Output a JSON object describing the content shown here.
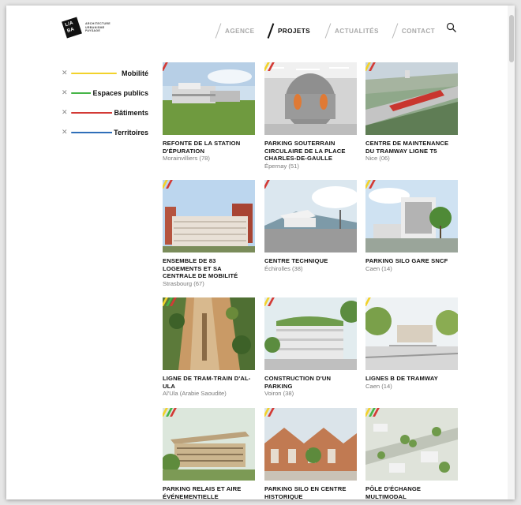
{
  "logo": {
    "mark_line1": "L/A",
    "mark_line2": "BA",
    "tagline": [
      "ARCHITECTURE",
      "URBANISME",
      "PAYSAGE"
    ]
  },
  "nav": {
    "items": [
      {
        "label": "AGENCE",
        "active": false
      },
      {
        "label": "PROJETS",
        "active": true
      },
      {
        "label": "ACTUALITÉS",
        "active": false
      },
      {
        "label": "CONTACT",
        "active": false
      }
    ],
    "search_icon": "search-icon"
  },
  "colors": {
    "yellow": "#f2d22b",
    "green": "#46b548",
    "red": "#d33a35",
    "blue": "#2f6fb9"
  },
  "filters": [
    {
      "label": "Mobilité",
      "color": "#f2d22b"
    },
    {
      "label": "Espaces publics",
      "color": "#46b548"
    },
    {
      "label": "Bâtiments",
      "color": "#d33a35"
    },
    {
      "label": "Territoires",
      "color": "#2f6fb9"
    }
  ],
  "projects": [
    {
      "title": "REFONTE DE LA STATION D'ÉPURATION",
      "location": "Morainvilliers (78)",
      "tags": [
        "red"
      ],
      "scene": "plant"
    },
    {
      "title": "PARKING SOUTERRAIN CIRCULAIRE DE LA PLACE CHARLES-DE-GAULLE",
      "location": "Épernay (51)",
      "tags": [
        "yellow",
        "red"
      ],
      "scene": "underground"
    },
    {
      "title": "CENTRE DE MAINTENANCE DU TRAMWAY LIGNE T5",
      "location": "Nice (06)",
      "tags": [
        "yellow",
        "red"
      ],
      "scene": "depot"
    },
    {
      "title": "ENSEMBLE DE 83 LOGEMENTS ET SA CENTRALE DE MOBILITÉ",
      "location": "Strasbourg (67)",
      "tags": [
        "yellow",
        "red"
      ],
      "scene": "housing"
    },
    {
      "title": "CENTRE TECHNIQUE",
      "location": "Échirolles (38)",
      "tags": [
        "red"
      ],
      "scene": "technique"
    },
    {
      "title": "PARKING SILO GARE SNCF",
      "location": "Caen (14)",
      "tags": [
        "yellow",
        "red"
      ],
      "scene": "silo"
    },
    {
      "title": "LIGNE DE TRAM-TRAIN D'AL-ULA",
      "location": "Al'Ula (Arabie Saoudite)",
      "tags": [
        "yellow",
        "green",
        "red"
      ],
      "scene": "desert"
    },
    {
      "title": "CONSTRUCTION D'UN PARKING",
      "location": "Voiron (38)",
      "tags": [
        "yellow",
        "red"
      ],
      "scene": "green"
    },
    {
      "title": "LIGNES B DE TRAMWAY",
      "location": "Caen (14)",
      "tags": [
        "yellow"
      ],
      "scene": "tram"
    },
    {
      "title": "PARKING RELAIS ET AIRE ÉVÉNEMENTIELLE",
      "location": "",
      "tags": [
        "yellow",
        "green",
        "red"
      ],
      "scene": "relais"
    },
    {
      "title": "PARKING SILO EN CENTRE HISTORIQUE",
      "location": "",
      "tags": [
        "yellow",
        "red"
      ],
      "scene": "historic"
    },
    {
      "title": "PÔLE D'ÉCHANGE MULTIMODAL",
      "location": "",
      "tags": [
        "yellow",
        "green",
        "red"
      ],
      "scene": "aerial"
    }
  ]
}
